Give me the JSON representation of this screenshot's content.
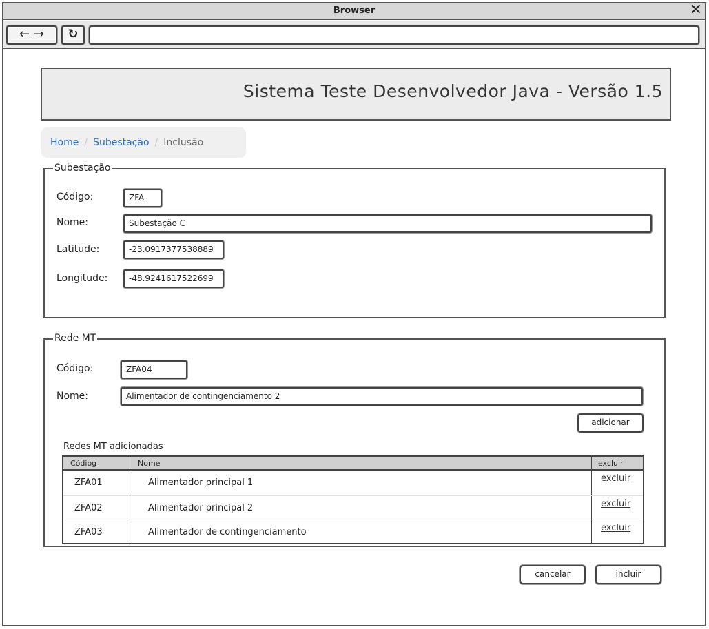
{
  "browser": {
    "title": "Browser",
    "close_glyph": "✕",
    "back_forward_glyph": "← →",
    "reload_glyph": "↻",
    "url": ""
  },
  "header": {
    "title": "Sistema Teste Desenvolvedor Java -  Versão 1.5"
  },
  "breadcrumb": {
    "home": "Home",
    "separator": "/",
    "section": "Subestação",
    "current": "Inclusão"
  },
  "subestacao": {
    "legend": "Subestação",
    "codigo_label": "Código:",
    "codigo_value": "ZFA",
    "nome_label": "Nome:",
    "nome_value": "Subestação C",
    "latitude_label": "Latitude:",
    "latitude_value": "-23.0917377538889",
    "longitude_label": "Longitude:",
    "longitude_value": "-48.9241617522699"
  },
  "rede_mt": {
    "legend": "Rede MT",
    "codigo_label": "Código:",
    "codigo_value": "ZFA04",
    "nome_label": "Nome:",
    "nome_value": "Alimentador de contingenciamento 2",
    "add_button": "adicionar",
    "table_title": "Redes MT adicionadas",
    "columns": [
      "Códiog",
      "Nome",
      "excluir"
    ],
    "rows": [
      {
        "codigo": "ZFA01",
        "nome": "Alimentador principal 1",
        "action": "excluir"
      },
      {
        "codigo": "ZFA02",
        "nome": "Alimentador principal 2",
        "action": "excluir"
      },
      {
        "codigo": "ZFA03",
        "nome": "Alimentador de contingenciamento",
        "action": "excluir"
      }
    ]
  },
  "footer": {
    "cancel_button": "cancelar",
    "submit_button": "incluir"
  }
}
